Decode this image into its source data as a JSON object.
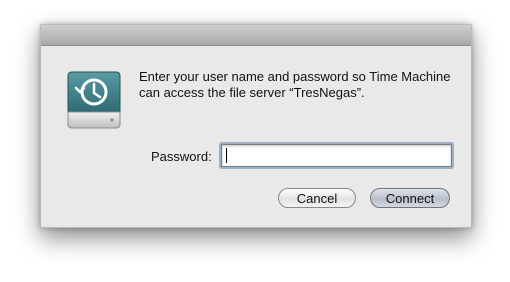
{
  "dialog": {
    "message": "Enter your user name and password so Time Machine can access the file server “TresNegas”.",
    "password_label": "Password:",
    "password_value": "",
    "cancel_label": "Cancel",
    "connect_label": "Connect",
    "icon": "time-machine-drive-icon"
  },
  "colors": {
    "dialog_background": "#e9e9e9",
    "icon_face": "#3f7f88",
    "default_button": "#b9c0cc"
  }
}
